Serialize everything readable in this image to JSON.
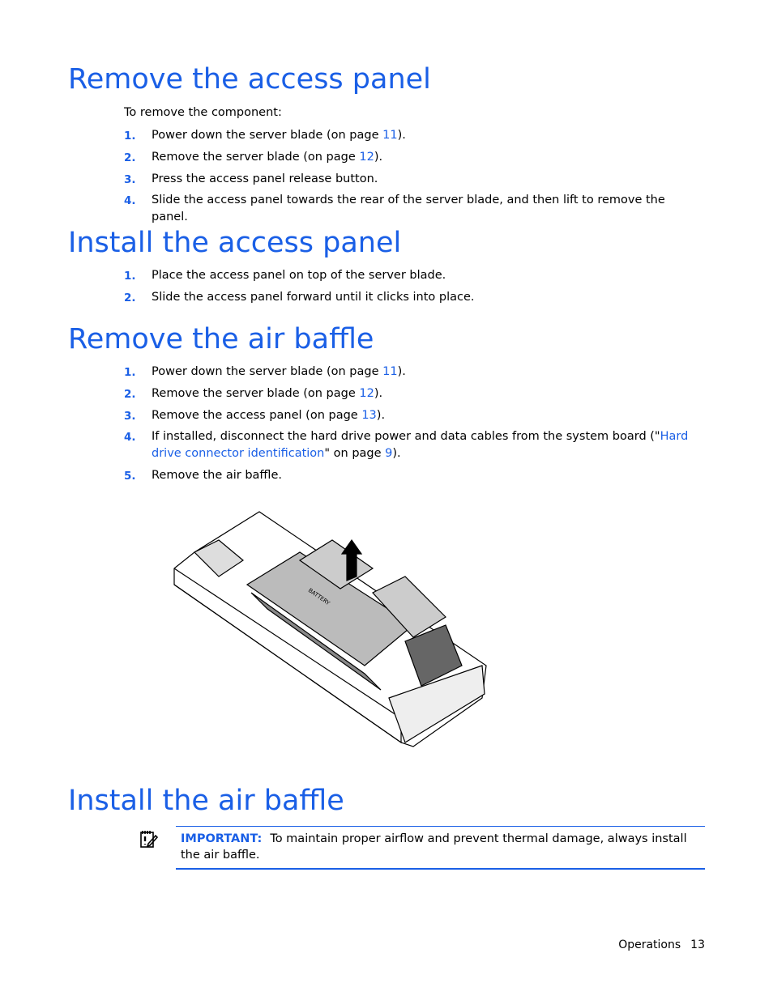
{
  "sections": [
    {
      "title": "Remove the access panel",
      "intro": "To remove the component:",
      "steps": [
        {
          "n": "1.",
          "pre": "Power down the server blade (on page ",
          "link": "11",
          "post": ")."
        },
        {
          "n": "2.",
          "pre": "Remove the server blade (on page ",
          "link": "12",
          "post": ")."
        },
        {
          "n": "3.",
          "pre": "Press the access panel release button.",
          "link": "",
          "post": ""
        },
        {
          "n": "4.",
          "pre": "Slide the access panel towards the rear of the server blade, and then lift to remove the panel.",
          "link": "",
          "post": ""
        }
      ]
    },
    {
      "title": "Install the access panel",
      "steps": [
        {
          "n": "1.",
          "pre": "Place the access panel on top of the server blade.",
          "link": "",
          "post": ""
        },
        {
          "n": "2.",
          "pre": "Slide the access panel forward until it clicks into place.",
          "link": "",
          "post": ""
        }
      ]
    },
    {
      "title": "Remove the air baffle",
      "steps": [
        {
          "n": "1.",
          "pre": "Power down the server blade (on page ",
          "link": "11",
          "post": ")."
        },
        {
          "n": "2.",
          "pre": "Remove the server blade (on page ",
          "link": "12",
          "post": ")."
        },
        {
          "n": "3.",
          "pre": "Remove the access panel (on page ",
          "link": "13",
          "post": ")."
        },
        {
          "n": "4.",
          "pre": "If installed, disconnect the hard drive power and data cables from the system board (\"",
          "link": "Hard drive connector identification",
          "mid": "\" on page ",
          "link2": "9",
          "post": ")."
        },
        {
          "n": "5.",
          "pre": "Remove the air baffle.",
          "link": "",
          "post": ""
        }
      ]
    },
    {
      "title": "Install the air baffle"
    }
  ],
  "illustration": {
    "label": "BATTERY"
  },
  "important": {
    "label": "IMPORTANT:",
    "text": "To maintain proper airflow and prevent thermal damage, always install the air baffle.",
    "icon": "important-notepad-icon"
  },
  "footer": {
    "section": "Operations",
    "page": "13"
  },
  "colors": {
    "heading": "#1a5fe6",
    "link": "#1a5fe6"
  }
}
